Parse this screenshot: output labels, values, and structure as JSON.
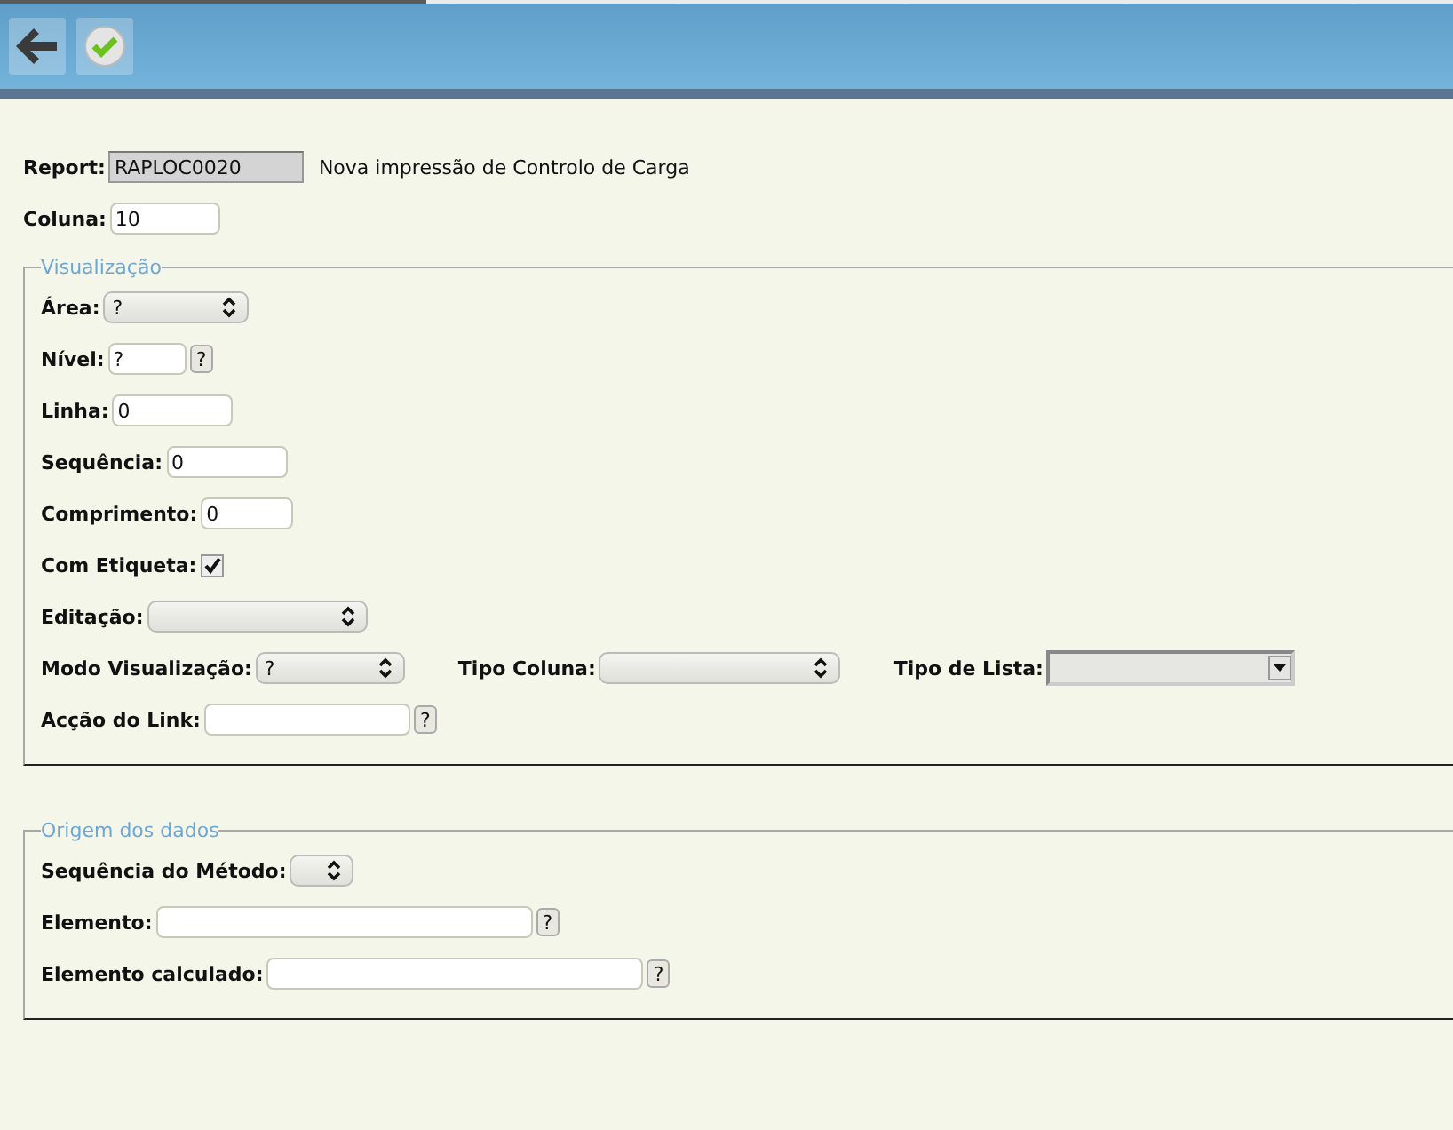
{
  "toolbar": {
    "buttons": [
      {
        "kind": "back"
      },
      {
        "kind": "confirm"
      }
    ]
  },
  "header": {
    "report": {
      "label": "Report:",
      "value": "RAPLOC0020",
      "disabled": true,
      "description": "Nova impressão de Controlo de Carga"
    },
    "column": {
      "label": "Coluna:",
      "value": "10"
    }
  },
  "sections": [
    {
      "title": "Visualização",
      "rows": [
        [
          {
            "label": "Área:",
            "kind": "select",
            "value": "?"
          }
        ],
        [
          {
            "label": "Nível:",
            "kind": "text",
            "value": "?",
            "help": "?"
          }
        ],
        [
          {
            "label": "Linha:",
            "kind": "text",
            "value": "0"
          }
        ],
        [
          {
            "label": "Sequência:",
            "kind": "text",
            "value": "0"
          }
        ],
        [
          {
            "label": "Comprimento:",
            "kind": "text",
            "value": "0"
          }
        ],
        [
          {
            "label": "Com Etiqueta:",
            "kind": "checkbox",
            "checked": true
          }
        ],
        [
          {
            "label": "Editação:",
            "kind": "select"
          }
        ],
        [
          {
            "label": "Modo Visualização:",
            "kind": "select",
            "value": "?"
          },
          {
            "label": "Tipo Coluna:",
            "kind": "select"
          },
          {
            "label": "Tipo de Lista:",
            "kind": "list"
          }
        ],
        [
          {
            "label": "Acção do Link:",
            "kind": "text",
            "help": "?"
          }
        ]
      ]
    },
    {
      "title": "Origem dos dados",
      "rows": [
        [
          {
            "label": "Sequência do Método:",
            "kind": "select"
          }
        ],
        [
          {
            "label": "Elemento:",
            "kind": "text",
            "help": "?"
          }
        ],
        [
          {
            "label": "Elemento calculado:",
            "kind": "text",
            "help": "?"
          }
        ]
      ]
    }
  ]
}
